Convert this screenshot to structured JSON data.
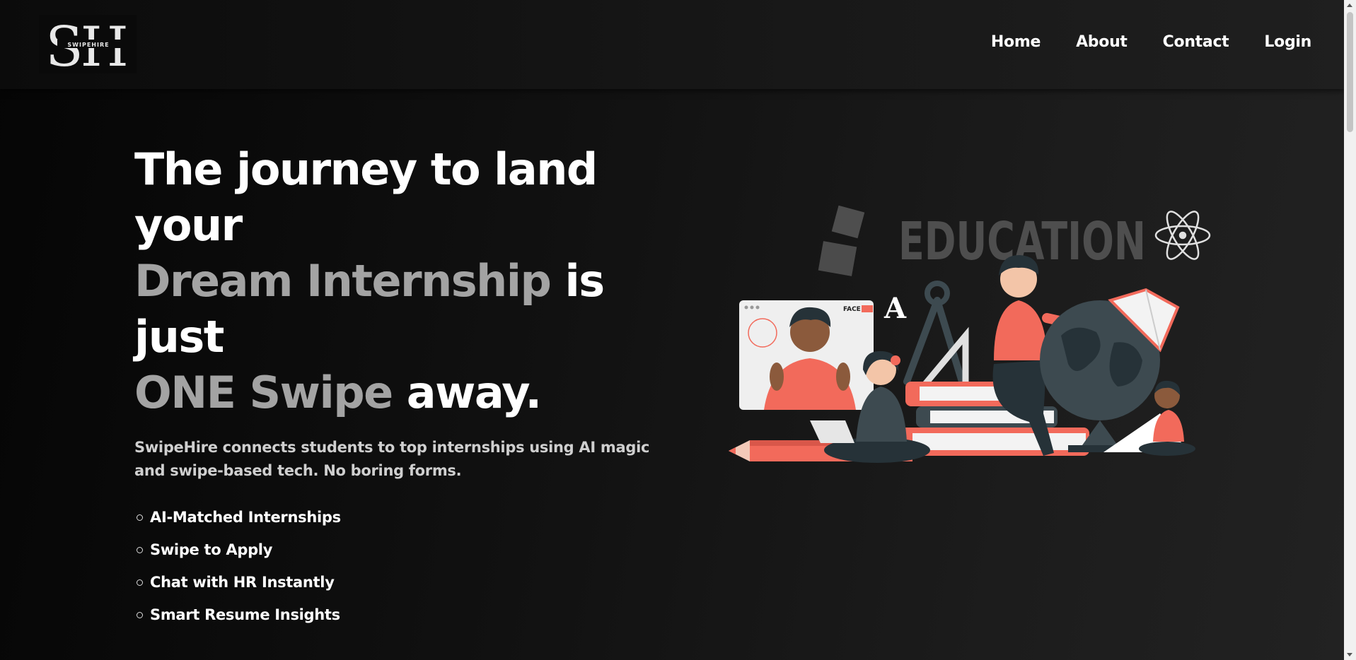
{
  "nav": {
    "logo_text": "SH",
    "logo_subtext": "SWIPEHIRE",
    "links": [
      {
        "label": "Home"
      },
      {
        "label": "About"
      },
      {
        "label": "Contact"
      },
      {
        "label": "Login"
      }
    ]
  },
  "hero": {
    "headline": {
      "part1": "The journey to land your",
      "accent1": "Dream Internship",
      "part2": " is just",
      "accent2": "ONE Swipe",
      "part3": " away."
    },
    "subtitle": "SwipeHire connects students to top internships using AI magic and swipe-based tech. No boring forms.",
    "features": [
      "AI-Matched Internships",
      "Swipe to Apply",
      "Chat with HR Instantly",
      "Smart Resume Insights"
    ]
  },
  "illustration": {
    "banner_text": "EDUCATION",
    "letter": "A",
    "video_brand": "FACE"
  },
  "colors": {
    "accent_coral": "#f26a5b",
    "muted_text": "#a3a3a3",
    "illustration_gray": "#4b4b4b"
  }
}
